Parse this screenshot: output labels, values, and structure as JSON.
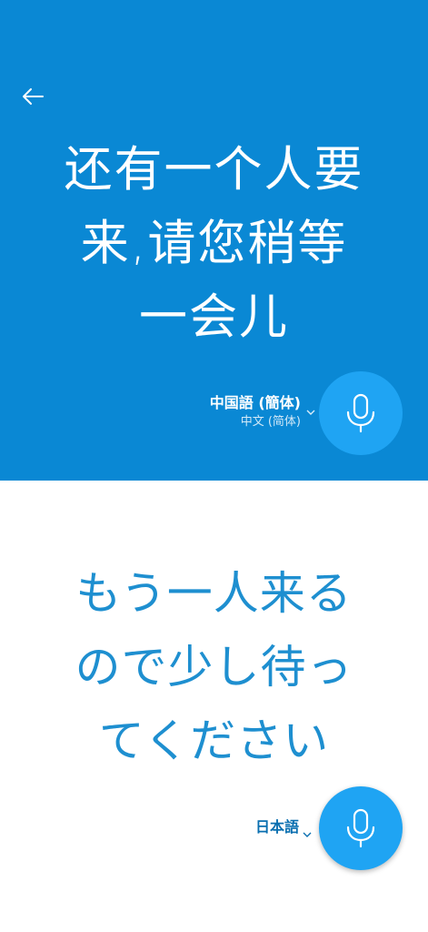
{
  "colors": {
    "top_background": "#0a88d4",
    "bottom_background": "#ffffff",
    "mic_button": "#1fa4f3",
    "target_text": "#1e8fd0",
    "target_lang": "#0a6fb0"
  },
  "header": {
    "back_icon": "arrow-left-icon"
  },
  "source": {
    "text_lines": [
      "还有一个人要",
      "来,请您稍等",
      "一会儿"
    ],
    "language_primary": "中国語 (簡体)",
    "language_secondary": "中文 (简体)",
    "dropdown_icon": "chevron-down-icon",
    "mic_icon": "microphone-icon"
  },
  "target": {
    "text_lines": [
      "もう一人来る",
      "ので少し待っ",
      "てください"
    ],
    "language_primary": "日本語",
    "dropdown_icon": "chevron-down-icon",
    "mic_icon": "microphone-icon"
  }
}
